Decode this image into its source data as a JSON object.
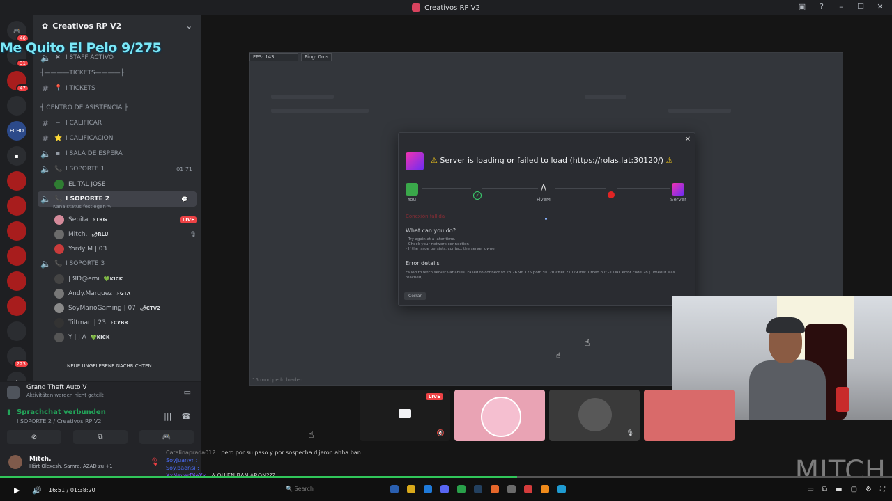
{
  "titlebar": {
    "title": "Creativos RP V2"
  },
  "overlay": {
    "text": "Me Quito El Pelo 9/275"
  },
  "rail": {
    "badges": [
      "46",
      "31",
      "47",
      "223"
    ],
    "echo_label": "ECHO"
  },
  "sidebar": {
    "server_name": "Creativos RP V2",
    "channels": [
      {
        "label": "I STAFF ACTIVO",
        "emoji": "✖"
      },
      {
        "category": "┤————TICKETS————├"
      },
      {
        "label": "I TICKETS",
        "emoji": "📍"
      },
      {
        "category": "┤ CENTRO DE ASISTENCIA ├"
      },
      {
        "label": "I CALIFICAR",
        "emoji": "━"
      },
      {
        "label": "I CALIFICACION",
        "emoji": "⭐"
      },
      {
        "label": "I SALA DE ESPERA",
        "emoji": "▪"
      },
      {
        "label": "I SOPORTE 1",
        "emoji": "📞",
        "count": "01   71"
      },
      {
        "user": "EL TAL JOSE"
      },
      {
        "label": "I SOPORTE 2",
        "emoji": "📞",
        "active": true,
        "subtext": "Kanalstatus festlegen ✎"
      },
      {
        "user": "Sebita",
        "tag": "⚡TRG",
        "live": "LIVE"
      },
      {
        "user": "Mitch.",
        "tag": "🌶RLU"
      },
      {
        "user": "Yordy M | 03"
      },
      {
        "label": "I SOPORTE 3",
        "emoji": "📞"
      },
      {
        "user": "| ЯD@emi",
        "tag": "💚KICK"
      },
      {
        "user": "Andy.Marquez",
        "tag": "⚡GTA"
      },
      {
        "user": "SoyMarioGaming | 07",
        "tag": "🌶CTV2"
      },
      {
        "user": "Tiltman | 23",
        "tag": "⚡CYBR"
      },
      {
        "user": "Y | J A",
        "tag": "💚KICK"
      }
    ],
    "new_messages": "NEUE UNGELESENE NACHRICHTEN"
  },
  "activity": {
    "game": "Grand Theft Auto V",
    "sub": "Aktivitäten werden nicht geteilt"
  },
  "voice": {
    "status": "Sprachchat verbunden",
    "channel": "I SOPORTE 2 / Creativos RP V2"
  },
  "user": {
    "name": "Mitch.",
    "status": "Hört Olexesh, Samra, AZAD zu +1"
  },
  "game": {
    "fps": "FPS: 143",
    "ping": "Ping: 0ms",
    "loaded_hint": "15 mod pedo loaded"
  },
  "modal": {
    "heading": "Server is loading or failed to load (https://rolas.lat:30120/)",
    "nodes": {
      "you": "You",
      "fivem": "FiveM",
      "server": "Server"
    },
    "faded": "Conexión fallida",
    "what_can_you_do": "What can you do?",
    "tips": [
      "- Try again at a later time.",
      "- Check your network connection",
      "- If the issue persists, contact the server owner"
    ],
    "error_details_title": "Error details",
    "error_details": "Failed to fetch server variables. Failed to connect to 23.26.96.125 port 30120 after 21029 ms: Timed out - CURL error code 28 (Timeout was reached)",
    "close_button": "Cerrar"
  },
  "thumbs": {
    "live": "LIVE"
  },
  "watermark": "MITCH",
  "chat": {
    "line1_user": "Catalinaprada012 :",
    "line1_text": "pero por su paso y por sospecha dijeron ahha ban",
    "line2_user": "SoyJuanvr :",
    "line3_user": "Soy.baensi :",
    "line4_user": "XxNeverDieXx :",
    "line4_text": "A QUIEN BANIARON???"
  },
  "player": {
    "time": "16:51 / 01:38:20",
    "search": "Search",
    "progress_percent": 58
  }
}
